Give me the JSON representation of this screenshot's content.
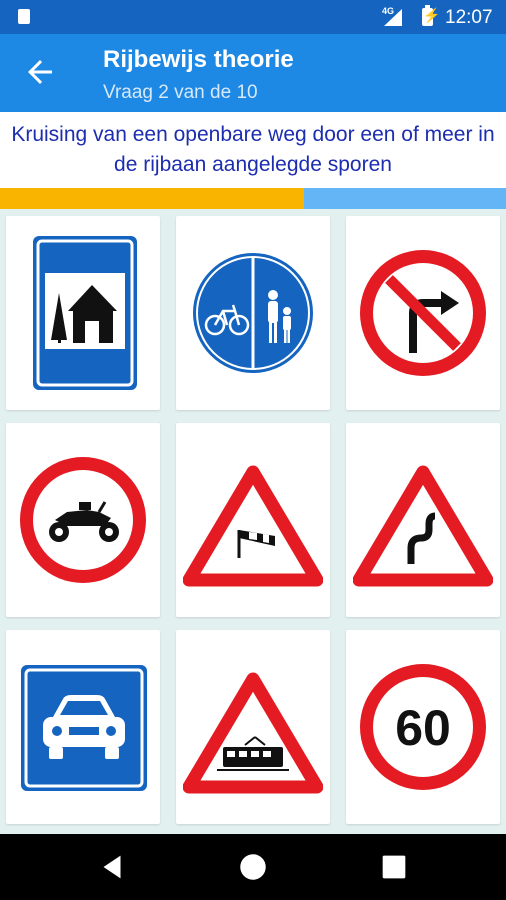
{
  "status_bar": {
    "network": "4G",
    "time": "12:07"
  },
  "app_bar": {
    "title": "Rijbewijs theorie",
    "subtitle": "Vraag 2 van de 10"
  },
  "question": {
    "text": "Kruising van een openbare weg door een of meer in de rijbaan aangelegde sporen"
  },
  "progress": {
    "fraction": 0.6,
    "fill_color": "#f9b400",
    "track_color": "#64b5f6"
  },
  "answers": [
    {
      "sign": "holiday-house-sign-icon"
    },
    {
      "sign": "bicycle-pedestrian-path-sign-icon"
    },
    {
      "sign": "no-right-turn-sign-icon"
    },
    {
      "sign": "no-quad-sign-icon"
    },
    {
      "sign": "side-wind-warning-sign-icon"
    },
    {
      "sign": "double-bend-warning-sign-icon"
    },
    {
      "sign": "motor-road-sign-icon"
    },
    {
      "sign": "tram-crossing-warning-sign-icon"
    },
    {
      "sign": "speed-limit-sign-icon",
      "value": "60"
    }
  ],
  "nav_bar": {
    "buttons": [
      "back-nav-icon",
      "home-nav-icon",
      "recents-nav-icon"
    ]
  }
}
